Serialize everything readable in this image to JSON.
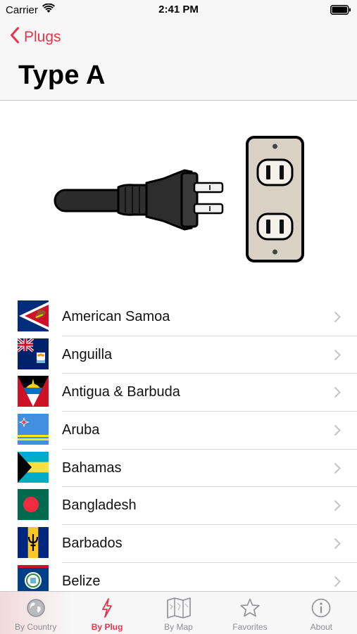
{
  "status": {
    "carrier": "Carrier",
    "time": "2:41 PM"
  },
  "nav": {
    "back_label": "Plugs",
    "title": "Type A"
  },
  "countries": [
    {
      "name": "American Samoa"
    },
    {
      "name": "Anguilla"
    },
    {
      "name": "Antigua & Barbuda"
    },
    {
      "name": "Aruba"
    },
    {
      "name": "Bahamas"
    },
    {
      "name": "Bangladesh"
    },
    {
      "name": "Barbados"
    },
    {
      "name": "Belize"
    }
  ],
  "tabs": [
    {
      "label": "By Country",
      "icon": "globe-icon"
    },
    {
      "label": "By Plug",
      "icon": "lightning-icon",
      "active": true
    },
    {
      "label": "By Map",
      "icon": "map-icon"
    },
    {
      "label": "Favorites",
      "icon": "star-icon"
    },
    {
      "label": "About",
      "icon": "info-icon"
    }
  ],
  "colors": {
    "accent": "#e8344a"
  }
}
